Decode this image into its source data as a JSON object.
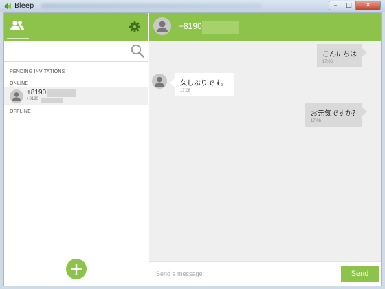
{
  "window": {
    "title": "Bleep",
    "buttons": {
      "minimize": "–",
      "maximize": "□",
      "close": "✕"
    }
  },
  "colors": {
    "accent": "#8dc24b",
    "chat_bg": "#efefef",
    "outgoing_bubble": "#d9d9d9",
    "incoming_bubble": "#ffffff"
  },
  "sidebar": {
    "icons": {
      "contacts": "contacts-icon",
      "settings": "gear-icon",
      "search": "search-icon",
      "add": "plus-icon"
    },
    "search": {
      "placeholder": ""
    },
    "sections": {
      "pending": "PENDING INVITATIONS",
      "online": "ONLINE",
      "offline": "OFFLINE"
    },
    "contacts": [
      {
        "name": "+8190",
        "sub": "+8190"
      }
    ]
  },
  "chat": {
    "header_name": "+8190",
    "messages": [
      {
        "direction": "out",
        "text": "こんにちは",
        "time": "17:06"
      },
      {
        "direction": "in",
        "text": "久しぶりです。",
        "time": "17:06"
      },
      {
        "direction": "out",
        "text": "お元気ですか？",
        "time": "17:06"
      }
    ],
    "composer": {
      "placeholder": "Send a message.",
      "send_label": "Send"
    }
  }
}
